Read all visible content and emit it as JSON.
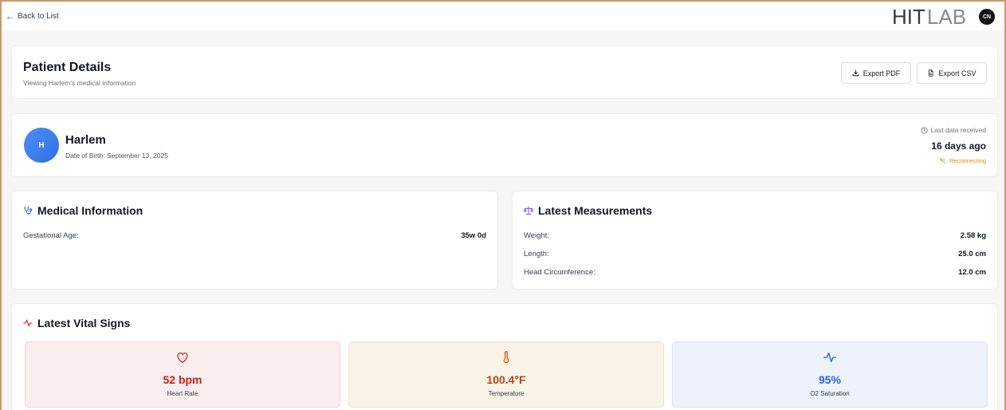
{
  "topbar": {
    "back_label": "Back to List",
    "brand_part1": "HIT",
    "brand_part2": "LAB",
    "user_initials": "CN"
  },
  "header": {
    "title": "Patient Details",
    "subtitle": "Viewing Harlem's medical information",
    "export_pdf_label": "Export PDF",
    "export_csv_label": "Export CSV"
  },
  "patient": {
    "initial": "H",
    "name": "Harlem",
    "dob": "Date of Birth: September 13, 2025",
    "last_data_label": "Last data received",
    "last_data_value": "16 days ago",
    "connection_status": "Reconnecting"
  },
  "medical_info": {
    "title": "Medical Information",
    "rows": [
      {
        "label": "Gestational Age:",
        "value": "35w 0d"
      }
    ]
  },
  "measurements": {
    "title": "Latest Measurements",
    "rows": [
      {
        "label": "Weight:",
        "value": "2.58 kg"
      },
      {
        "label": "Length:",
        "value": "25.0 cm"
      },
      {
        "label": "Head Circumference:",
        "value": "12.0 cm"
      }
    ]
  },
  "vitals": {
    "title": "Latest Vital Signs",
    "items": [
      {
        "value": "52 bpm",
        "label": "Heart Rate",
        "icon": "heart-icon",
        "color": "#c81e1e"
      },
      {
        "value": "100.4°F",
        "label": "Temperature",
        "icon": "thermometer-icon",
        "color": "#c2410c"
      },
      {
        "value": "95%",
        "label": "O2 Saturation",
        "icon": "pulse-icon",
        "color": "#2563eb"
      }
    ]
  },
  "colors": {
    "accent_blue": "#2f6fe4",
    "warning_orange": "#ea8a0c",
    "vital_red": "#c81e1e",
    "vital_orange": "#c2410c",
    "vital_blue": "#2563eb",
    "measure_purple": "#8b5cf6"
  }
}
